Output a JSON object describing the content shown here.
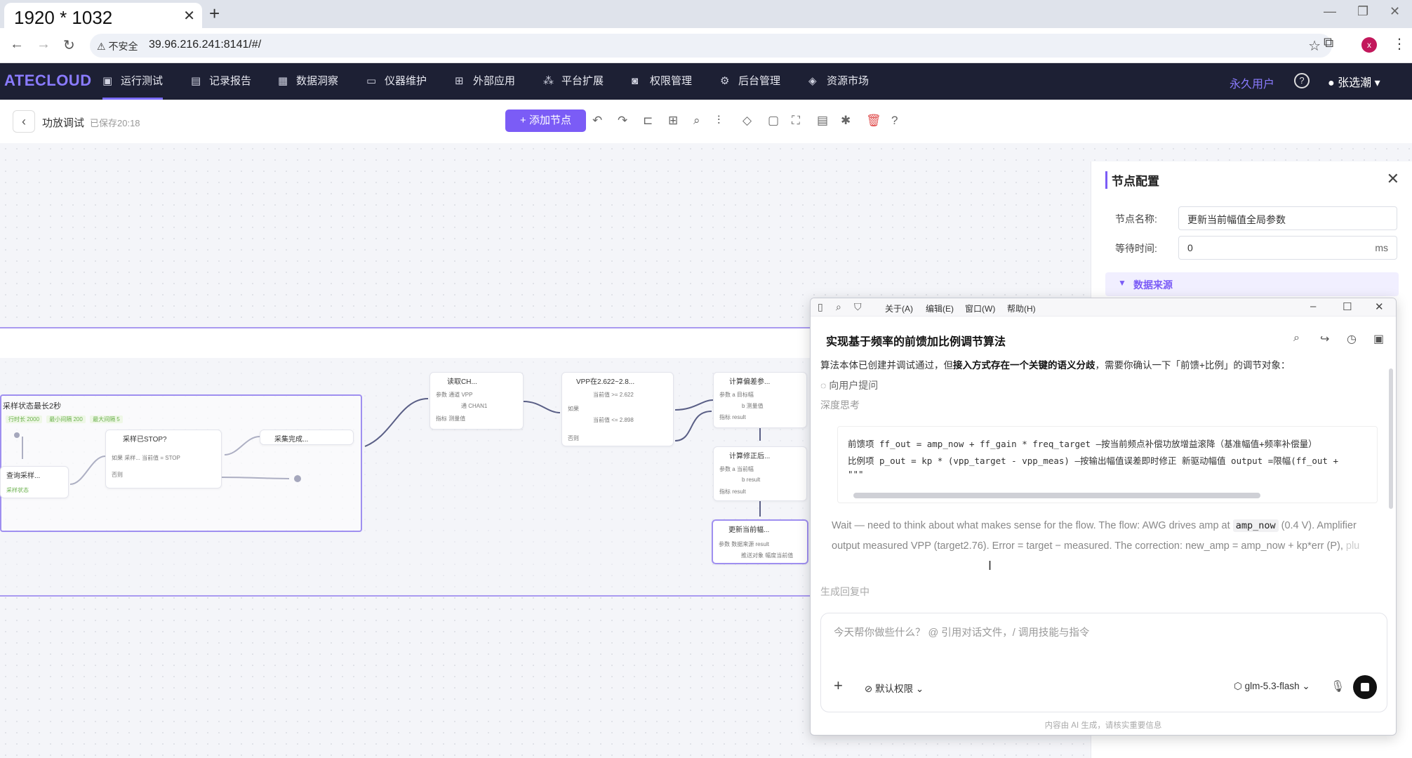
{
  "browser": {
    "tab_title": "1920 * 1032",
    "insecure_label": "不安全",
    "url": "39.96.216.241:8141/#/",
    "profile_initial": "x"
  },
  "appnav": {
    "logo": "ATECLOUD",
    "items": [
      {
        "label": "运行测试",
        "icon": "monitor-icon"
      },
      {
        "label": "记录报告",
        "icon": "clipboard-icon"
      },
      {
        "label": "数据洞察",
        "icon": "chart-icon"
      },
      {
        "label": "仪器维护",
        "icon": "instrument-icon"
      },
      {
        "label": "外部应用",
        "icon": "grid-icon"
      },
      {
        "label": "平台扩展",
        "icon": "extension-icon"
      },
      {
        "label": "权限管理",
        "icon": "lock-icon"
      },
      {
        "label": "后台管理",
        "icon": "settings-icon"
      },
      {
        "label": "资源市场",
        "icon": "tag-icon"
      }
    ],
    "user_tier": "永久用户",
    "user_name": "张选潮"
  },
  "toolbar": {
    "page_title": "功放调试",
    "saved": "已保存20:18",
    "add_node": "添加节点"
  },
  "canvas": {
    "group_title": "采样状态最长2秒",
    "group_params": [
      "行时长 2000",
      "最小间隔 200",
      "最大间隔 5"
    ],
    "nodes": [
      {
        "title": "采样已STOP?",
        "rows": [
          "如果  采样...  当前值  =  STOP",
          "否则"
        ]
      },
      {
        "title": "采集完成...",
        "rows": []
      },
      {
        "title": "查询采样...",
        "rows": [
          "采样状态"
        ]
      },
      {
        "title": "读取CH...",
        "rows": [
          "参数  通道 VPP",
          "通 CHAN1",
          "指标  测量值"
        ]
      },
      {
        "title": "VPP在2.622~2.8...",
        "rows": [
          "当前值  >=  2.622",
          "如果",
          "当前值  <=  2.898",
          "否则"
        ]
      },
      {
        "title": "计算偏差参...",
        "rows": [
          "参数  a 目标幅",
          "b 测量值",
          "指标  result"
        ]
      },
      {
        "title": "计算修正后...",
        "rows": [
          "参数  a 当前幅",
          "b result",
          "指标  result"
        ]
      },
      {
        "title": "更新当前幅...",
        "rows": [
          "参数  数据来源 result",
          "推送对象 幅度当前值"
        ]
      }
    ]
  },
  "config": {
    "title": "节点配置",
    "name_label": "节点名称:",
    "name_value": "更新当前幅值全局参数",
    "wait_label": "等待时间:",
    "wait_value": "0",
    "wait_unit": "ms",
    "source_label": "数据来源"
  },
  "chat": {
    "menus": [
      "关于(A)",
      "编辑(E)",
      "窗口(W)",
      "帮助(H)"
    ],
    "title": "实现基于频率的前馈加比例调节算法",
    "line1_pre": "算法本体已创建并调试通过，但",
    "line1_bold": "接入方式存在一个关键的语义分歧",
    "line1_post": "，需要你确认一下「前馈+比例」的调节对象：",
    "ask_user": "向用户提问",
    "deep_think": "深度思考",
    "code_lines": [
      "前馈项 ff_out = amp_now + ff_gain * freq_target —按当前频点补偿功放增益滚降（基准幅值+频率补偿量）",
      "比例项 p_out = kp * (vpp_target - vpp_meas) —按输出幅值误差即时修正 新驱动幅值 output =限幅(ff_out +",
      "\"\"\""
    ],
    "think_pre": "Wait — need to think about what makes sense for the flow. The flow: AWG drives amp at ",
    "think_code": "amp_now",
    "think_mid": " (0.4 V). Amplifier output measured VPP (target2.76). Error = target − measured. The correction: new_amp = amp_now + kp*err (P), ",
    "think_fade": "plu",
    "generating": "生成回复中",
    "input_placeholder": "今天帮你做些什么？ @ 引用对话文件，/ 调用技能与指令",
    "permission": "默认权限",
    "model": "glm-5.3-flash",
    "footer": "内容由 AI 生成，请核实重要信息"
  }
}
